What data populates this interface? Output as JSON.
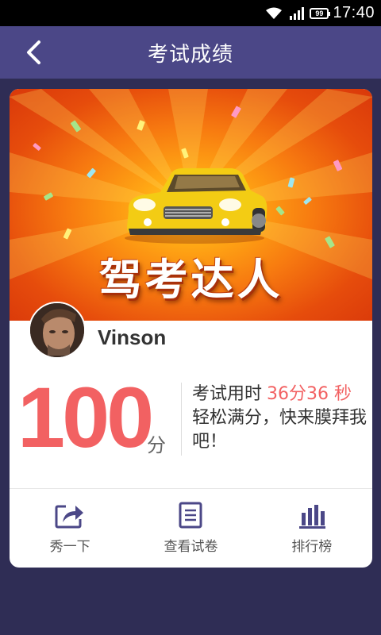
{
  "status_bar": {
    "battery": "99",
    "time": "17:40",
    "icons": [
      "wifi-icon",
      "signal-icon",
      "battery-icon"
    ]
  },
  "header": {
    "title": "考试成绩",
    "back_icon": "chevron-left-icon"
  },
  "banner": {
    "slogan": "驾考达人"
  },
  "user": {
    "name": "Vinson"
  },
  "result": {
    "score": "100",
    "unit": "分",
    "time_label": "考试用时",
    "time_value": "36分36 秒",
    "message": "轻松满分，快来膜拜我吧！"
  },
  "actions": [
    {
      "label": "秀一下",
      "icon": "share-icon"
    },
    {
      "label": "查看试卷",
      "icon": "document-icon"
    },
    {
      "label": "排行榜",
      "icon": "bar-chart-icon"
    }
  ],
  "colors": {
    "header_bg": "#4b4787",
    "page_bg": "#2f2d55",
    "accent": "#f26162",
    "icon_color": "#4b4787"
  }
}
